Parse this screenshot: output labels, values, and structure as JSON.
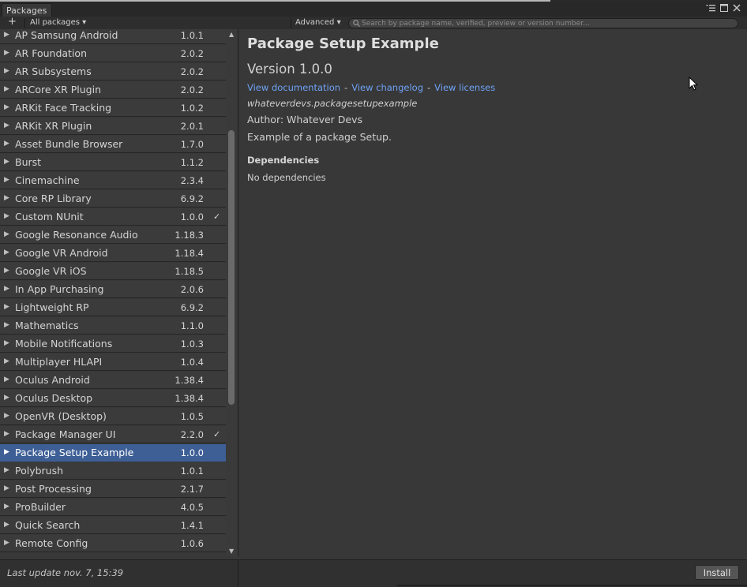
{
  "window": {
    "tab_label": "Packages",
    "menu_icon": "context-menu-icon",
    "maximize_icon": "maximize-icon",
    "close_icon": "close-icon"
  },
  "toolbar": {
    "add_label": "+",
    "filter_label": "All packages ▾",
    "advanced_label": "Advanced ▾",
    "search_placeholder": "Search by package name, verified, preview or version number..."
  },
  "packages": [
    {
      "name": "AP Samsung Android",
      "version": "1.0.1",
      "check": ""
    },
    {
      "name": "AR Foundation",
      "version": "2.0.2",
      "check": ""
    },
    {
      "name": "AR Subsystems",
      "version": "2.0.2",
      "check": ""
    },
    {
      "name": "ARCore XR Plugin",
      "version": "2.0.2",
      "check": ""
    },
    {
      "name": "ARKit Face Tracking",
      "version": "1.0.2",
      "check": ""
    },
    {
      "name": "ARKit XR Plugin",
      "version": "2.0.1",
      "check": ""
    },
    {
      "name": "Asset Bundle Browser",
      "version": "1.7.0",
      "check": ""
    },
    {
      "name": "Burst",
      "version": "1.1.2",
      "check": ""
    },
    {
      "name": "Cinemachine",
      "version": "2.3.4",
      "check": ""
    },
    {
      "name": "Core RP Library",
      "version": "6.9.2",
      "check": ""
    },
    {
      "name": "Custom NUnit",
      "version": "1.0.0",
      "check": "✓"
    },
    {
      "name": "Google Resonance Audio",
      "version": "1.18.3",
      "check": ""
    },
    {
      "name": "Google VR Android",
      "version": "1.18.4",
      "check": ""
    },
    {
      "name": "Google VR iOS",
      "version": "1.18.5",
      "check": ""
    },
    {
      "name": "In App Purchasing",
      "version": "2.0.6",
      "check": ""
    },
    {
      "name": "Lightweight RP",
      "version": "6.9.2",
      "check": ""
    },
    {
      "name": "Mathematics",
      "version": "1.1.0",
      "check": ""
    },
    {
      "name": "Mobile Notifications",
      "version": "1.0.3",
      "check": ""
    },
    {
      "name": "Multiplayer HLAPI",
      "version": "1.0.4",
      "check": ""
    },
    {
      "name": "Oculus Android",
      "version": "1.38.4",
      "check": ""
    },
    {
      "name": "Oculus Desktop",
      "version": "1.38.4",
      "check": ""
    },
    {
      "name": "OpenVR (Desktop)",
      "version": "1.0.5",
      "check": ""
    },
    {
      "name": "Package Manager UI",
      "version": "2.2.0",
      "check": "✓"
    },
    {
      "name": "Package Setup Example",
      "version": "1.0.0",
      "check": "",
      "selected": true
    },
    {
      "name": "Polybrush",
      "version": "1.0.1",
      "check": ""
    },
    {
      "name": "Post Processing",
      "version": "2.1.7",
      "check": ""
    },
    {
      "name": "ProBuilder",
      "version": "4.0.5",
      "check": ""
    },
    {
      "name": "Quick Search",
      "version": "1.4.1",
      "check": ""
    },
    {
      "name": "Remote Config",
      "version": "1.0.6",
      "check": ""
    }
  ],
  "details": {
    "title": "Package Setup Example",
    "version": "Version 1.0.0",
    "link_documentation": "View documentation",
    "link_changelog": "View changelog",
    "link_licenses": "View licenses",
    "separator": "-",
    "package_id": "whateverdevs.packagesetupexample",
    "author": "Author: Whatever Devs",
    "description": "Example of a package Setup.",
    "dependencies_header": "Dependencies",
    "dependencies_text": "No dependencies"
  },
  "footer": {
    "last_update": "Last update nov. 7, 15:39",
    "install_label": "Install"
  }
}
